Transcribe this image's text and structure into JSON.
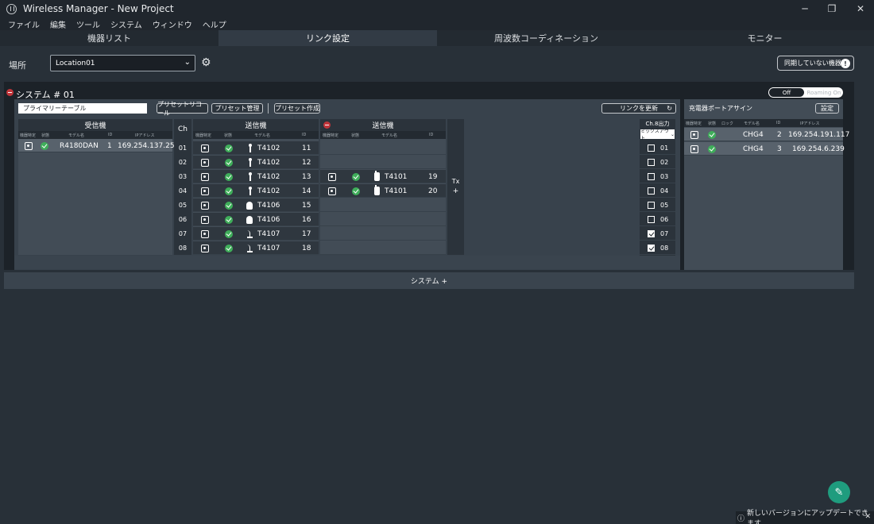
{
  "window": {
    "title": "Wireless Manager - New Project",
    "minimize": "─",
    "restore": "❐",
    "close": "✕"
  },
  "menu": [
    "ファイル",
    "編集",
    "ツール",
    "システム",
    "ウィンドウ",
    "ヘルプ"
  ],
  "tabs": [
    {
      "label": "機器リスト",
      "active": false
    },
    {
      "label": "リンク設定",
      "active": true
    },
    {
      "label": "周波数コーディネーション",
      "active": false
    },
    {
      "label": "モニター",
      "active": false
    }
  ],
  "location": {
    "label": "場所",
    "value": "Location01",
    "unsynced_button": "同期していない機器"
  },
  "system": {
    "title": "システム # 01",
    "roaming_off": "Off",
    "roaming_on": "Roaming On",
    "preset_name": "プライマリーテーブル",
    "buttons": {
      "preset_recall": "プリセットリコール",
      "preset_manage": "プリセット管理",
      "preset_create": "プリセット作成",
      "update_links": "リンクを更新"
    },
    "receiver": {
      "header": "受信機",
      "sub": {
        "identify": "機器特定",
        "status": "状態",
        "model": "モデル名",
        "id": "ID",
        "ip": "IPアドレス"
      },
      "rows": [
        {
          "model": "R4180DAN",
          "id": "1",
          "ip": "169.254.137.250"
        }
      ]
    },
    "ch_header": "Ch",
    "channels": [
      "01",
      "02",
      "03",
      "04",
      "05",
      "06",
      "07",
      "08"
    ],
    "transmitter1": {
      "header": "送信機",
      "sub": {
        "identify": "機器特定",
        "status": "状態",
        "model": "モデル名",
        "id": "ID"
      },
      "rows": [
        {
          "model": "T4102",
          "id": "11",
          "icon": "handheld"
        },
        {
          "model": "T4102",
          "id": "12",
          "icon": "handheld"
        },
        {
          "model": "T4102",
          "id": "13",
          "icon": "handheld"
        },
        {
          "model": "T4102",
          "id": "14",
          "icon": "handheld"
        },
        {
          "model": "T4106",
          "id": "15",
          "icon": "boundary"
        },
        {
          "model": "T4106",
          "id": "16",
          "icon": "boundary"
        },
        {
          "model": "T4107",
          "id": "17",
          "icon": "gooseneck"
        },
        {
          "model": "T4107",
          "id": "18",
          "icon": "gooseneck"
        }
      ]
    },
    "transmitter2": {
      "header": "送信機",
      "sub": {
        "identify": "機器特定",
        "status": "状態",
        "model": "モデル名",
        "id": "ID"
      },
      "rows": [
        {
          "model": "T4101",
          "id": "19",
          "icon": "bodypack"
        },
        {
          "model": "T4101",
          "id": "20",
          "icon": "bodypack"
        }
      ]
    },
    "tx_add": {
      "label": "Tx",
      "plus": "+"
    },
    "mix": {
      "header": "Ch.8出力",
      "select": "ミックスアウト",
      "channels": [
        {
          "num": "01",
          "checked": false
        },
        {
          "num": "02",
          "checked": false
        },
        {
          "num": "03",
          "checked": false
        },
        {
          "num": "04",
          "checked": false
        },
        {
          "num": "05",
          "checked": false
        },
        {
          "num": "06",
          "checked": false
        },
        {
          "num": "07",
          "checked": true
        },
        {
          "num": "08",
          "checked": true
        }
      ]
    },
    "charger": {
      "title": "充電器ポートアサイン",
      "settings": "設定",
      "sub": {
        "identify": "機器特定",
        "status": "状態",
        "lock": "ロック",
        "model": "モデル名",
        "id": "ID",
        "ip": "IPアドレス"
      },
      "rows": [
        {
          "model": "CHG4",
          "id": "2",
          "ip": "169.254.191.117"
        },
        {
          "model": "CHG4",
          "id": "3",
          "ip": "169.254.6.239"
        }
      ]
    }
  },
  "add_system": "システム +",
  "update_notice": "新しいバージョンにアップデートできます",
  "colors": {
    "ok": "#3fae5a",
    "remove": "#c0353a",
    "fab": "#1f9c7e"
  }
}
